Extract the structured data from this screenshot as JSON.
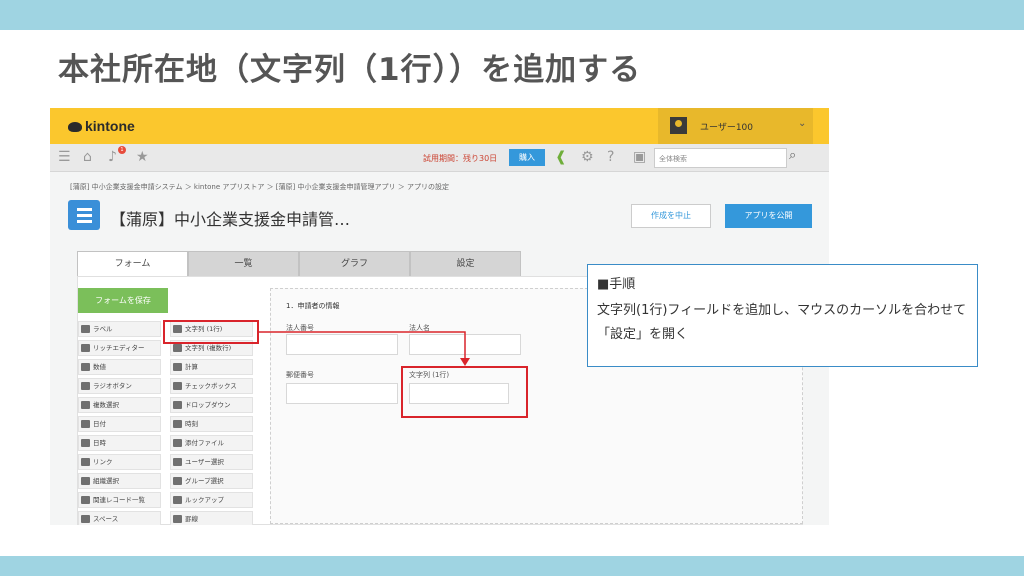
{
  "slide": {
    "title": "本社所在地（文字列（1行））を追加する"
  },
  "header": {
    "logo_text": "kintone",
    "user_name": "ユーザー100",
    "caret": "⌄"
  },
  "nav": {
    "badge_count": "1",
    "trial_text": "試用期間：残り30日",
    "buy_label": "購入",
    "search_placeholder": "全体検索"
  },
  "breadcrumb": "[蒲原] 中小企業支援金申請システム ＞ kintone アプリストア ＞ [蒲原] 中小企業支援金申請管理アプリ ＞ アプリの設定",
  "app": {
    "name": "【蒲原】中小企業支援金申請管…",
    "cancel_label": "作成を中止",
    "publish_label": "アプリを公開"
  },
  "tabs": [
    "フォーム",
    "一覧",
    "グラフ",
    "設定"
  ],
  "form": {
    "save_label": "フォームを保存",
    "palette": [
      "ラベル",
      "文字列 (1行)",
      "リッチエディター",
      "文字列 (複数行)",
      "数値",
      "計算",
      "ラジオボタン",
      "チェックボックス",
      "複数選択",
      "ドロップダウン",
      "日付",
      "時刻",
      "日時",
      "添付ファイル",
      "リンク",
      "ユーザー選択",
      "組織選択",
      "グループ選択",
      "関連レコード一覧",
      "ルックアップ",
      "スペース",
      "罫線"
    ],
    "group_title": "1．申請者の情報",
    "fields": [
      "法人番号",
      "法人名",
      "郵便番号",
      "文字列 (1行)"
    ]
  },
  "callout": {
    "heading": "■手順",
    "body": "文字列(1行)フィールドを追加し、マウスのカーソルを合わせて「設定」を開く"
  },
  "colors": {
    "highlight": "#d9242b",
    "header": "#fbc72d",
    "accent": "#3498db",
    "band": "#9fd4e2"
  }
}
